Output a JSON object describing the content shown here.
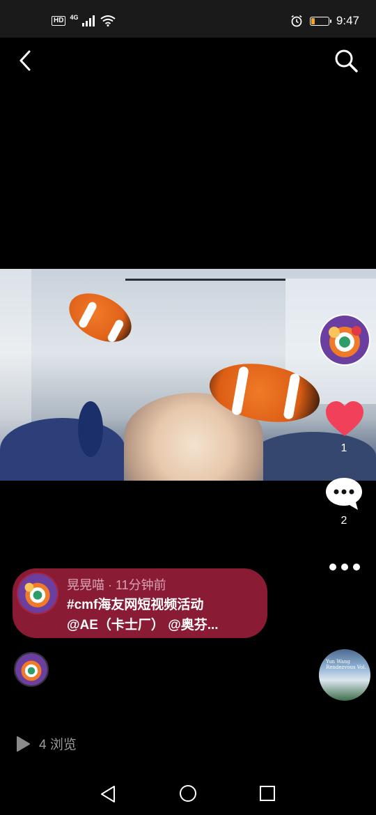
{
  "status_bar": {
    "network": "4G",
    "hd": "HD",
    "time": "9:47",
    "battery_level": 0.2,
    "icons": [
      "signal-icon",
      "wifi-icon",
      "alarm-icon",
      "battery-icon"
    ]
  },
  "nav": {
    "back_icon": "back-arrow-icon",
    "search_icon": "search-icon"
  },
  "video": {
    "subject": "clownfish aquarium"
  },
  "actions": {
    "like_count": "1",
    "comment_count": "2",
    "like_color": "#f0405a"
  },
  "caption": {
    "meta": "晃晃喵 · 11分钟前",
    "line1": "#cmf海友网短视频活动",
    "line2": "@AE（卡士厂） @奥芬...",
    "card_color": "#8a1b35"
  },
  "music": {
    "disc_text_1": "Yun Wang",
    "disc_text_2": "Rendezvous Vol."
  },
  "views": {
    "label": "4 浏览"
  },
  "system_nav": {
    "icons": [
      "nav-back-icon",
      "nav-home-icon",
      "nav-recent-icon"
    ]
  }
}
